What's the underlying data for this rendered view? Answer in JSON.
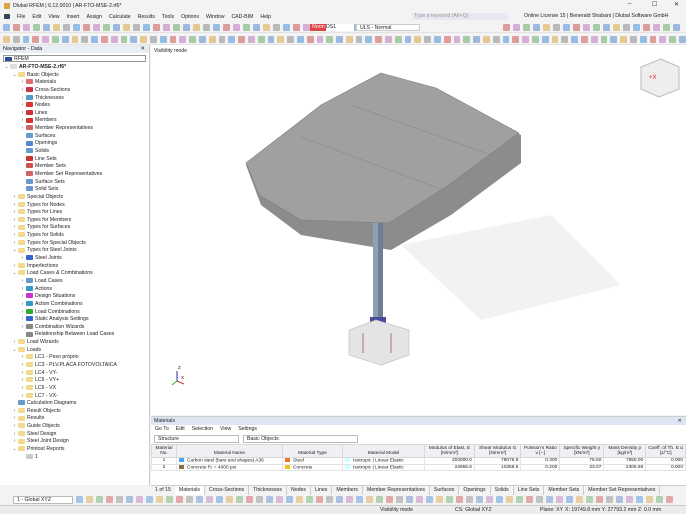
{
  "window": {
    "title": "Dlubal RFEM | 6.12.0010 | AR-FTO-MSE-2.rf6*",
    "minimize": "–",
    "maximize": "☐",
    "close": "✕"
  },
  "menu": [
    "File",
    "Edit",
    "View",
    "Insert",
    "Assign",
    "Calculate",
    "Results",
    "Tools",
    "Options",
    "Window",
    "CAD-BIM",
    "Help"
  ],
  "search": {
    "placeholder": "Type a keyword (Alt+Q)"
  },
  "license": "Online License 15 | Benerald Shabani | Dlubal Software GmbH",
  "toolbar": {
    "loadcase_badge": "Norm",
    "loadcase": "DS1",
    "combo": "ULS - Normal"
  },
  "navigator": {
    "title": "Navigator - Data",
    "root_selector": "RFEM",
    "tree": [
      {
        "l": 0,
        "e": "v",
        "t": "AR-FTO-MSE-2.rf6*",
        "c": "#ddd",
        "b": 1
      },
      {
        "l": 1,
        "e": "v",
        "t": "Basic Objects",
        "c": "#f3d98b"
      },
      {
        "l": 2,
        "e": ">",
        "t": "Materials",
        "c": "#e06b6b"
      },
      {
        "l": 2,
        "e": ">",
        "t": "Cross-Sections",
        "c": "#c34"
      },
      {
        "l": 2,
        "e": ">",
        "t": "Thicknesses",
        "c": "#59c"
      },
      {
        "l": 2,
        "e": ">",
        "t": "Nodes",
        "c": "#d33"
      },
      {
        "l": 2,
        "e": ">",
        "t": "Lines",
        "c": "#c33"
      },
      {
        "l": 2,
        "e": ">",
        "t": "Members",
        "c": "#c33"
      },
      {
        "l": 2,
        "e": ">",
        "t": "Member Representatives",
        "c": "#c66"
      },
      {
        "l": 2,
        "e": "",
        "t": "Surfaces",
        "c": "#69c"
      },
      {
        "l": 2,
        "e": "",
        "t": "Openings",
        "c": "#58c"
      },
      {
        "l": 2,
        "e": "",
        "t": "Solids",
        "c": "#69c"
      },
      {
        "l": 2,
        "e": "",
        "t": "Line Sets",
        "c": "#c33"
      },
      {
        "l": 2,
        "e": "",
        "t": "Member Sets",
        "c": "#c55"
      },
      {
        "l": 2,
        "e": "",
        "t": "Member Set Representatives",
        "c": "#c66"
      },
      {
        "l": 2,
        "e": "",
        "t": "Surface Sets",
        "c": "#69c"
      },
      {
        "l": 2,
        "e": "",
        "t": "Solid Sets",
        "c": "#69c"
      },
      {
        "l": 1,
        "e": ">",
        "t": "Special Objects",
        "c": "#f3d98b"
      },
      {
        "l": 1,
        "e": ">",
        "t": "Types for Nodes",
        "c": "#f3d98b"
      },
      {
        "l": 1,
        "e": ">",
        "t": "Types for Lines",
        "c": "#f3d98b"
      },
      {
        "l": 1,
        "e": ">",
        "t": "Types for Members",
        "c": "#f3d98b"
      },
      {
        "l": 1,
        "e": ">",
        "t": "Types for Surfaces",
        "c": "#f3d98b"
      },
      {
        "l": 1,
        "e": ">",
        "t": "Types for Solids",
        "c": "#f3d98b"
      },
      {
        "l": 1,
        "e": ">",
        "t": "Types for Special Objects",
        "c": "#f3d98b"
      },
      {
        "l": 1,
        "e": "v",
        "t": "Types for Steel Joints",
        "c": "#f3d98b"
      },
      {
        "l": 2,
        "e": ">",
        "t": "Steel Joints",
        "c": "#36c"
      },
      {
        "l": 1,
        "e": ">",
        "t": "Imperfections",
        "c": "#f3d98b"
      },
      {
        "l": 1,
        "e": "v",
        "t": "Load Cases & Combinations",
        "c": "#f3d98b"
      },
      {
        "l": 2,
        "e": ">",
        "t": "Load Cases",
        "c": "#69c"
      },
      {
        "l": 2,
        "e": ">",
        "t": "Actions",
        "c": "#39c"
      },
      {
        "l": 2,
        "e": ">",
        "t": "Design Situations",
        "c": "#c3c"
      },
      {
        "l": 2,
        "e": ">",
        "t": "Action Combinations",
        "c": "#39c"
      },
      {
        "l": 2,
        "e": ">",
        "t": "Load Combinations",
        "c": "#3a3"
      },
      {
        "l": 2,
        "e": ">",
        "t": "Static Analysis Settings",
        "c": "#36c"
      },
      {
        "l": 2,
        "e": ">",
        "t": "Combination Wizards",
        "c": "#888"
      },
      {
        "l": 2,
        "e": "",
        "t": "Relationship Between Load Cases",
        "c": "#888"
      },
      {
        "l": 1,
        "e": ">",
        "t": "Load Wizards",
        "c": "#f3d98b"
      },
      {
        "l": 1,
        "e": "v",
        "t": "Loads",
        "c": "#f3d98b"
      },
      {
        "l": 2,
        "e": ">",
        "t": "LC1 - Peso próprio",
        "c": "#f3d98b"
      },
      {
        "l": 2,
        "e": ">",
        "t": "LC3 - PLV.PLACA FOTOVOLTAICA",
        "c": "#f3d98b"
      },
      {
        "l": 2,
        "e": ">",
        "t": "LC4 - VY-",
        "c": "#f3d98b"
      },
      {
        "l": 2,
        "e": ">",
        "t": "LC5 - VY+",
        "c": "#f3d98b"
      },
      {
        "l": 2,
        "e": ">",
        "t": "LC6 - VX",
        "c": "#f3d98b"
      },
      {
        "l": 2,
        "e": ">",
        "t": "LC7 - VX-",
        "c": "#f3d98b"
      },
      {
        "l": 1,
        "e": "",
        "t": "Calculation Diagrams",
        "c": "#69c"
      },
      {
        "l": 1,
        "e": ">",
        "t": "Result Objects",
        "c": "#f3d98b"
      },
      {
        "l": 1,
        "e": ">",
        "t": "Results",
        "c": "#f3d98b"
      },
      {
        "l": 1,
        "e": ">",
        "t": "Guide Objects",
        "c": "#f3d98b"
      },
      {
        "l": 1,
        "e": ">",
        "t": "Steel Design",
        "c": "#f3d98b"
      },
      {
        "l": 1,
        "e": ">",
        "t": "Steel Joint Design",
        "c": "#f3d98b"
      },
      {
        "l": 1,
        "e": "v",
        "t": "Printout Reports",
        "c": "#f3d98b"
      },
      {
        "l": 2,
        "e": "",
        "t": "1",
        "c": "#ccc"
      }
    ]
  },
  "viewport": {
    "mode_label": "Visibility mode",
    "cube_label": "+X",
    "axis_x": "X",
    "axis_z": "Z"
  },
  "materials": {
    "title": "Materials",
    "menu": [
      "Go To",
      "Edit",
      "Selection",
      "View",
      "Settings"
    ],
    "structure_select": "Structure",
    "objects_select": "Basic Objects",
    "columns": [
      "Material No.",
      "Material Name",
      "Material Type",
      "Material Model",
      "Modulus of Elast. E [N/mm²]",
      "Shear Modulus G [N/mm²]",
      "Poisson's Ratio ν [--]",
      "Specific Weight γ [kN/m³]",
      "Mass Density ρ [kg/m³]",
      "Coeff. of Th. E α [1/°C]"
    ],
    "rows": [
      {
        "no": "1",
        "name": "Carbon steel (bars and shapes) A36",
        "name_color": "#4aa3f0",
        "type": "Steel",
        "type_color": "#e8742a",
        "model": "Isotropic | Linear Elastic",
        "E": "203000.0",
        "G": "78076.9",
        "nu": "0.300",
        "gamma": "78.50",
        "rho": "7850.00",
        "alpha": "0.000"
      },
      {
        "no": "2",
        "name": "Concrete f'c = 4000 psi",
        "name_color": "#8b6b4a",
        "type": "Concrete",
        "type_color": "#f2c21b",
        "model": "Isotropic | Linear Elastic",
        "E": "24855.6",
        "G": "10356.5",
        "nu": "0.200",
        "gamma": "23.07",
        "rho": "2306.66",
        "alpha": "0.000"
      }
    ]
  },
  "tabs": {
    "pager": "1 of 15",
    "items": [
      "Materials",
      "Cross-Sections",
      "Thicknesses",
      "Nodes",
      "Lines",
      "Members",
      "Member Representatives",
      "Surfaces",
      "Openings",
      "Solids",
      "Line Sets",
      "Member Sets",
      "Member Set Representatives"
    ]
  },
  "bottom": {
    "cs_select": "1 - Global XYZ"
  },
  "status": {
    "mode": "Visibility mode",
    "cs": "CS: Global XYZ",
    "plane": "Plane: XY",
    "coords": "X: 19749.8 mm  Y: 37793.2 mm  Z: 0.0 mm"
  }
}
